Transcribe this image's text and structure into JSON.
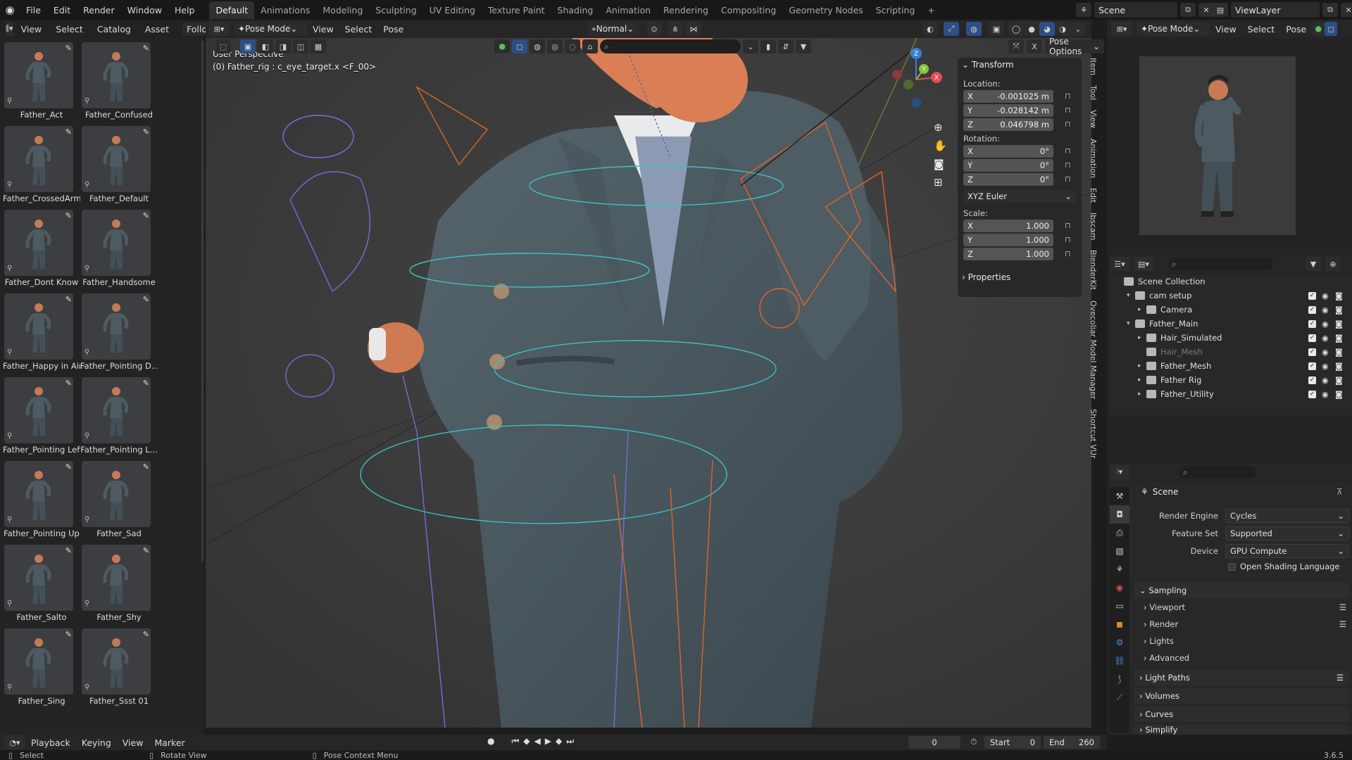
{
  "topbar": {
    "menus": [
      "File",
      "Edit",
      "Render",
      "Window",
      "Help"
    ],
    "workspaces": [
      "Default",
      "Animations",
      "Modeling",
      "Sculpting",
      "UV Editing",
      "Texture Paint",
      "Shading",
      "Animation",
      "Rendering",
      "Compositing",
      "Geometry Nodes",
      "Scripting"
    ],
    "active_workspace": "Default",
    "add_tab": "+",
    "scene": "Scene",
    "view_layer": "ViewLayer"
  },
  "asset_browser": {
    "menus": [
      "View",
      "Select",
      "Catalog",
      "Asset"
    ],
    "follow_label": "Follow",
    "assets": [
      "Father_Act",
      "Father_Confused",
      "Father_CrossedArm",
      "Father_Default",
      "Father_Dont Know",
      "Father_Handsome",
      "Father_Happy in Air",
      "Father_Pointing D...",
      "Father_Pointing Left",
      "Father_Pointing L...",
      "Father_Pointing Up",
      "Father_Sad",
      "Father_Salto",
      "Father_Shy",
      "Father_Sing",
      "Father_Ssst 01"
    ]
  },
  "viewport": {
    "mode": "Pose Mode",
    "menus": [
      "View",
      "Select",
      "Pose"
    ],
    "orientation": "Normal",
    "pose_options": "Pose Options",
    "overlay_title": "User Perspective",
    "overlay_object": "(0) Father_rig : c_eye_target.x <F_00>",
    "gizmo_axes": [
      "X",
      "Y",
      "Z"
    ]
  },
  "npanel": {
    "transform_label": "Transform",
    "location_label": "Location:",
    "location": [
      {
        "axis": "X",
        "value": "-0.001025 m"
      },
      {
        "axis": "Y",
        "value": "-0.028142 m"
      },
      {
        "axis": "Z",
        "value": "0.046798 m"
      }
    ],
    "rotation_label": "Rotation:",
    "rotation": [
      {
        "axis": "X",
        "value": "0°"
      },
      {
        "axis": "Y",
        "value": "0°"
      },
      {
        "axis": "Z",
        "value": "0°"
      }
    ],
    "rotation_mode": "XYZ Euler",
    "scale_label": "Scale:",
    "scale": [
      {
        "axis": "X",
        "value": "1.000"
      },
      {
        "axis": "Y",
        "value": "1.000"
      },
      {
        "axis": "Z",
        "value": "1.000"
      }
    ],
    "properties_label": "Properties",
    "side_tabs": [
      "Item",
      "Tool",
      "View",
      "Animation",
      "Edit",
      "Ibscam",
      "BlenderKit",
      "Ovecoliar Model Manager",
      "Shortcut VUr"
    ]
  },
  "preview_header": {
    "mode": "Pose Mode",
    "menus": [
      "View",
      "Select",
      "Pose"
    ]
  },
  "outliner": {
    "rows": [
      {
        "name": "Scene Collection",
        "indent": 0,
        "tri": ""
      },
      {
        "name": "cam setup",
        "indent": 1,
        "tri": "▾"
      },
      {
        "name": "Camera",
        "indent": 2,
        "tri": "▸"
      },
      {
        "name": "Father_Main",
        "indent": 1,
        "tri": "▾"
      },
      {
        "name": "Hair_Simulated",
        "indent": 2,
        "tri": "▸"
      },
      {
        "name": "Hair_Mesh",
        "indent": 2,
        "tri": ""
      },
      {
        "name": "Father_Mesh",
        "indent": 2,
        "tri": "▸"
      },
      {
        "name": "Father Rig",
        "indent": 2,
        "tri": "▸"
      },
      {
        "name": "Father_Utility",
        "indent": 2,
        "tri": "▸"
      }
    ]
  },
  "properties": {
    "scene_label": "Scene",
    "render_engine_label": "Render Engine",
    "render_engine": "Cycles",
    "feature_set_label": "Feature Set",
    "feature_set": "Supported",
    "device_label": "Device",
    "device": "GPU Compute",
    "osl_label": "Open Shading Language",
    "sections": [
      "Sampling",
      "Light Paths",
      "Volumes",
      "Curves",
      "Simplify"
    ],
    "sampling_sub": [
      "Viewport",
      "Render",
      "Lights",
      "Advanced"
    ]
  },
  "timeline": {
    "menus": [
      "Playback",
      "Keying",
      "View",
      "Marker"
    ],
    "current_frame": "0",
    "start_label": "Start",
    "start": "0",
    "end_label": "End",
    "end": "260"
  },
  "statusbar": {
    "select": "Select",
    "rotate": "Rotate View",
    "context": "Pose Context Menu",
    "version": "3.6.5"
  }
}
